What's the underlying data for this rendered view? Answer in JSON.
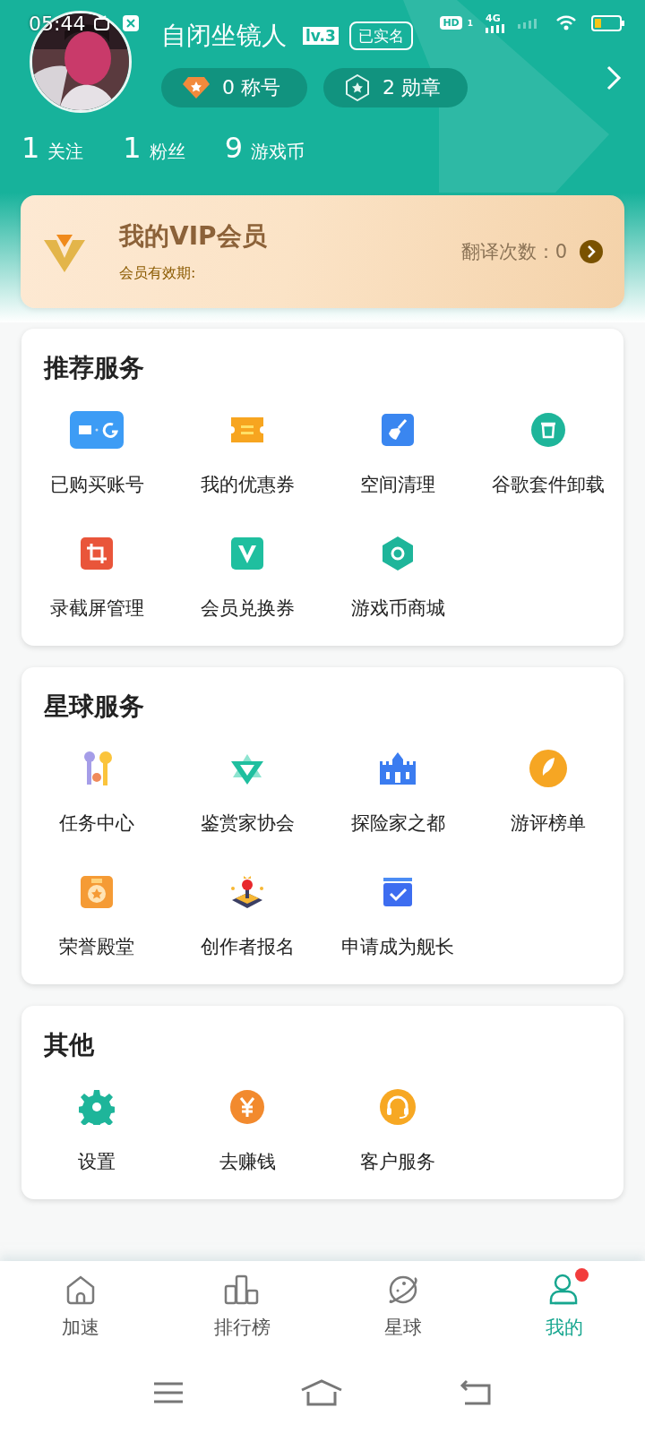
{
  "status_bar": {
    "time": "05:44",
    "hd_label": "HD",
    "sim_slot": "1",
    "network": "4G"
  },
  "profile": {
    "user_name": "自闭坐镜人",
    "level": "lv.3",
    "verified": "已实名",
    "chips": [
      {
        "kind": "title",
        "count": "0",
        "label": "称号"
      },
      {
        "kind": "medal",
        "count": "2",
        "label": "勋章"
      }
    ],
    "stats": [
      {
        "value": "1",
        "label": "关注"
      },
      {
        "value": "1",
        "label": "粉丝"
      },
      {
        "value": "9",
        "label": "游戏币"
      }
    ]
  },
  "vip": {
    "title": "我的VIP会员",
    "validity": "会员有效期:",
    "translate_count": "翻译次数：0"
  },
  "sections": [
    {
      "title": "推荐服务",
      "items": [
        {
          "kind": "account",
          "label": "已购买账号"
        },
        {
          "kind": "coupon",
          "label": "我的优惠券"
        },
        {
          "kind": "clean",
          "label": "空间清理"
        },
        {
          "kind": "uninstall",
          "label": "谷歌套件卸载"
        },
        {
          "kind": "crop",
          "label": "录截屏管理"
        },
        {
          "kind": "vcoupon",
          "label": "会员兑换券"
        },
        {
          "kind": "shop",
          "label": "游戏币商城"
        }
      ]
    },
    {
      "title": "星球服务",
      "items": [
        {
          "kind": "keys",
          "label": "任务中心"
        },
        {
          "kind": "hexagram",
          "label": "鉴赏家协会"
        },
        {
          "kind": "castle",
          "label": "探险家之都"
        },
        {
          "kind": "feather",
          "label": "游评榜单"
        },
        {
          "kind": "medal",
          "label": "荣誉殿堂"
        },
        {
          "kind": "joystick",
          "label": "创作者报名"
        },
        {
          "kind": "check",
          "label": "申请成为舰长"
        }
      ]
    },
    {
      "title": "其他",
      "items": [
        {
          "kind": "gear",
          "label": "设置"
        },
        {
          "kind": "yen",
          "label": "去赚钱"
        },
        {
          "kind": "headset",
          "label": "客户服务"
        }
      ]
    }
  ],
  "tabs": [
    {
      "kind": "home",
      "label": "加速",
      "selected": false,
      "badge": false
    },
    {
      "kind": "chart",
      "label": "排行榜",
      "selected": false,
      "badge": false
    },
    {
      "kind": "planet",
      "label": "星球",
      "selected": false,
      "badge": false
    },
    {
      "kind": "user",
      "label": "我的",
      "selected": true,
      "badge": true
    }
  ]
}
